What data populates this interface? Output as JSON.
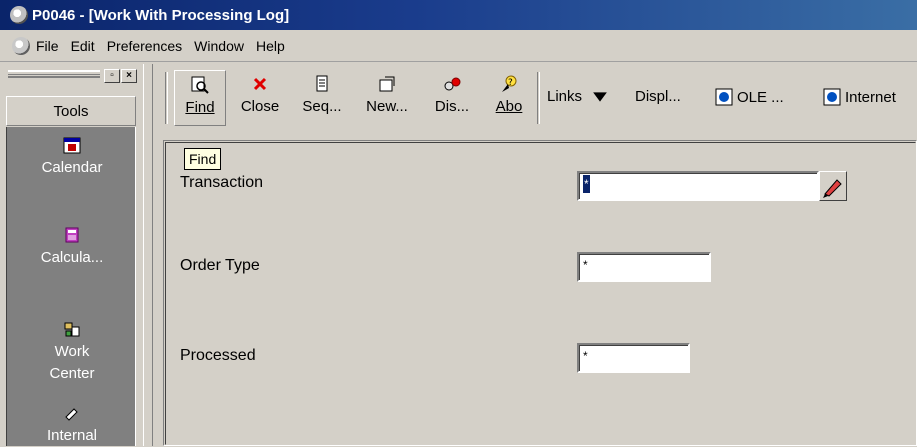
{
  "window": {
    "title": "P0046 - [Work With Processing Log]"
  },
  "menu": {
    "items": [
      "File",
      "Edit",
      "Preferences",
      "Window",
      "Help"
    ]
  },
  "tools_panel": {
    "header": "Tools",
    "items": [
      {
        "label": "Calendar",
        "icon": "calendar-icon"
      },
      {
        "label": "Calcula...",
        "icon": "calculator-icon"
      },
      {
        "label": "Work\nCenter",
        "icon": "work-center-icon"
      },
      {
        "label": "Internal",
        "icon": "internal-icon"
      }
    ]
  },
  "toolbar": {
    "buttons": [
      {
        "label": "Find",
        "icon": "find-icon"
      },
      {
        "label": "Close",
        "icon": "close-icon"
      },
      {
        "label": "Seq...",
        "icon": "sequence-icon"
      },
      {
        "label": "New...",
        "icon": "new-icon"
      },
      {
        "label": "Dis...",
        "icon": "display-icon"
      },
      {
        "label": "Abo",
        "icon": "about-icon"
      }
    ],
    "links_label": "Links",
    "display_label": "Displ...",
    "ole_label": "OLE ...",
    "internet_label": "Internet"
  },
  "tooltip": "Find",
  "form": {
    "transaction": {
      "label": "Transaction",
      "value": "*"
    },
    "order_type": {
      "label": "Order Type",
      "value": "*"
    },
    "processed": {
      "label": "Processed",
      "value": "*"
    }
  },
  "colors": {
    "title_bar": "#0a246a",
    "tools_bg": "#808080",
    "window_bg": "#d4d0c8"
  }
}
